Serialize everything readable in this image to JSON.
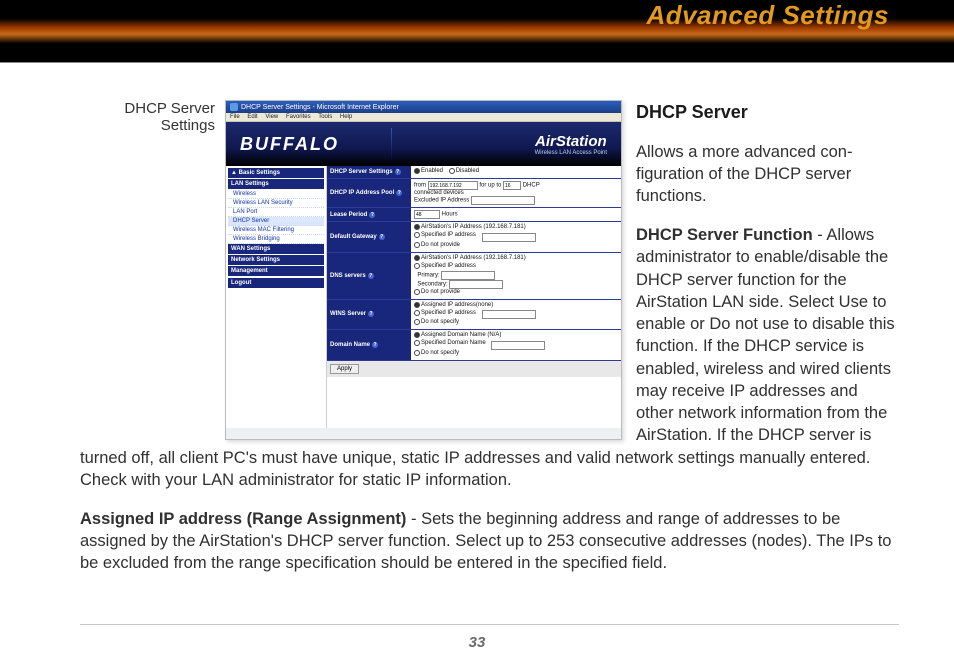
{
  "page": {
    "title": "Advanced Settings",
    "number": "33"
  },
  "caption": {
    "line1": "DHCP Server",
    "line2": "Settings"
  },
  "screenshot": {
    "window_title": "DHCP Server Settings - Microsoft Internet Explorer",
    "menubar": [
      "File",
      "Edit",
      "View",
      "Favorites",
      "Tools",
      "Help"
    ],
    "brand": "BUFFALO",
    "product": "AirStation",
    "product_sub": "Wireless LAN Access Point",
    "sidebar": {
      "basic": "▲ Basic Settings",
      "lan_header": "LAN Settings",
      "lan_items": [
        "Wireless",
        "Wireless LAN Security",
        "LAN Port",
        "DHCP Server",
        "Wireless MAC Filtering",
        "Wireless Bridging"
      ],
      "wan_header": "WAN Settings",
      "net_header": "Network Settings",
      "mgmt_header": "Management",
      "logout": "Logout"
    },
    "rows": {
      "dhcp_func": {
        "label": "DHCP Server Settings",
        "opt_enabled": "Enabled",
        "opt_disabled": "Disabled"
      },
      "pool": {
        "label": "DHCP IP Address Pool",
        "from": "from",
        "from_ip": "192.168.7.192",
        "forup": "for up to",
        "count": "16",
        "dhcp": "DHCP",
        "conn": "connected devices",
        "excl": "Excluded IP Address"
      },
      "lease": {
        "label": "Lease Period",
        "value": "48",
        "unit": "Hours"
      },
      "gateway": {
        "label": "Default Gateway",
        "opt1": "AirStation's IP Address (192.168.7.181)",
        "opt2": "Specified IP address",
        "opt3": "Do not provide"
      },
      "dns": {
        "label": "DNS servers",
        "opt1": "AirStation's IP Address (192.168.7.181)",
        "opt2": "Specified IP address",
        "pri": "Primary:",
        "sec": "Secondary:",
        "opt3": "Do not provide"
      },
      "wins": {
        "label": "WINS Server",
        "opt1": "Assigned IP address(none)",
        "opt2": "Specified IP address",
        "opt3": "Do not specify"
      },
      "domain": {
        "label": "Domain Name",
        "opt1": "Assigned Domain Name (N/A)",
        "opt2": "Specified Domain Name",
        "opt3": "Do not specify"
      }
    },
    "apply": "Apply"
  },
  "text": {
    "h": "DHCP Server",
    "p1": "Allows a more advanced con­figuration of the DHCP server functions.",
    "p2a": "DHCP Server Function",
    "p2b": " - Al­lows administrator to enable/disable the DHCP server func­tion for the AirStation LAN side. Select Use to enable or Do not use to disable this function. If the DHCP service is enabled, wireless and wired clients may receive IP addresses and other network information from the AirStation.  If the DHCP server is turned off, all client PC's must have unique, static IP addresses and valid network settings manually entered. Check with your LAN administrator for static IP information.",
    "p3a": "Assigned IP address (Range Assignment)",
    "p3b": " - Sets the beginning address and range of addresses to be assigned by the AirStation's DHCP server function.  Select up to 253 consecutive addresses (nodes).  The IPs to be excluded from the range specification should be entered in the specified field."
  }
}
